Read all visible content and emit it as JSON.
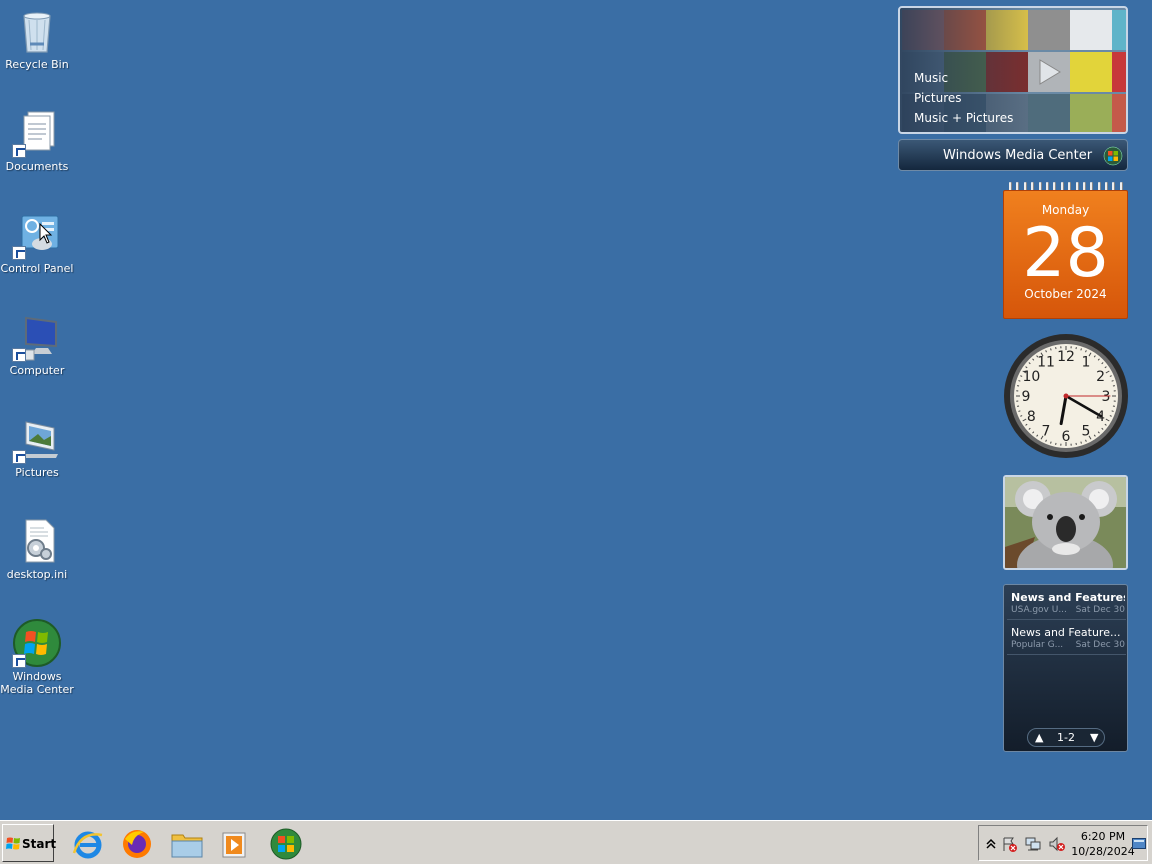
{
  "desktop": {
    "icons": [
      {
        "label": "Recycle Bin",
        "icon": "recycle-bin-icon"
      },
      {
        "label": "Documents",
        "icon": "documents-icon"
      },
      {
        "label": "Control Panel",
        "icon": "control-panel-icon"
      },
      {
        "label": "Computer",
        "icon": "computer-icon"
      },
      {
        "label": "Pictures",
        "icon": "pictures-icon"
      },
      {
        "label": "desktop.ini",
        "icon": "settings-file-icon"
      },
      {
        "label": "Windows Media Center",
        "icon": "windows-media-center-icon"
      }
    ]
  },
  "gadgets": {
    "media_center": {
      "menu": [
        "Music",
        "Pictures",
        "Music + Pictures"
      ],
      "title": "Windows Media Center"
    },
    "calendar": {
      "day_name": "Monday",
      "day_number": "28",
      "month_year": "October 2024"
    },
    "clock": {
      "numbers": [
        "12",
        "1",
        "2",
        "3",
        "4",
        "5",
        "6",
        "7",
        "8",
        "9",
        "10",
        "11"
      ],
      "time": "6:20"
    },
    "slideshow": {
      "subject": "koala photo"
    },
    "feeds": {
      "items": [
        {
          "title": "News and Features f...",
          "source": "USA.gov U...",
          "date": "Sat Dec 30"
        },
        {
          "title": "News and Feature...",
          "source": "Popular G...",
          "date": "Sat Dec 30"
        }
      ],
      "page_indicator": "1-2"
    }
  },
  "taskbar": {
    "start_label": "Start",
    "pinned": [
      "internet-explorer-icon",
      "firefox-icon",
      "windows-explorer-icon",
      "media-player-icon",
      "windows-media-center-icon"
    ],
    "tray": {
      "time": "6:20 PM",
      "date": "10/28/2024"
    }
  },
  "colors": {
    "desktop": "#3a6ea5",
    "calendar": "#e8680f",
    "taskbar": "#d6d3ce"
  }
}
